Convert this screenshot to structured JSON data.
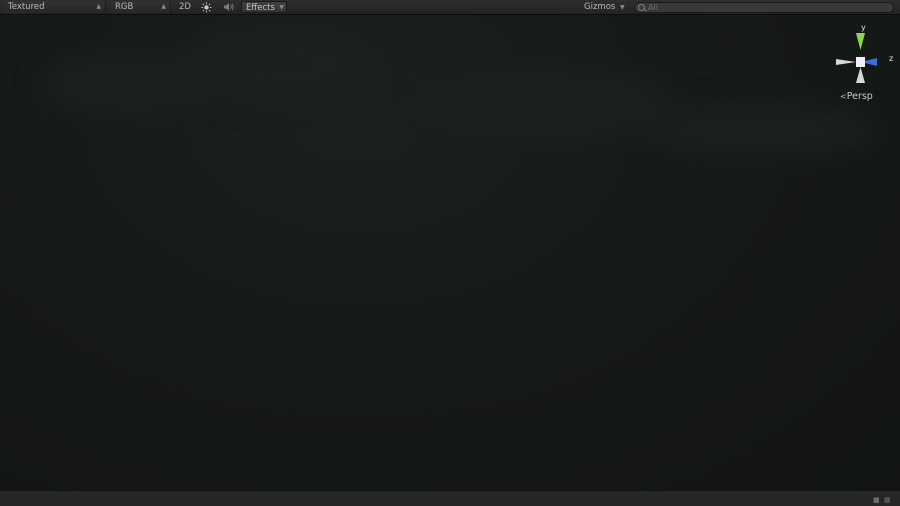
{
  "toolbar": {
    "draw_mode": "Textured",
    "render_mode": "RGB",
    "mode_2d": "2D",
    "lighting_icon": "sun-icon",
    "audio_icon": "speaker-icon",
    "effects_label": "Effects",
    "gizmos_label": "Gizmos",
    "search_placeholder": "All"
  },
  "scene_gizmo": {
    "y_label": "y",
    "z_label": "z",
    "projection_label": "Persp",
    "colors": {
      "y_axis": "#8bd54a",
      "z_axis": "#3a6fd8",
      "neutral": "#d8d8d8"
    }
  },
  "colors": {
    "viewport_bg": "#141716",
    "toolbar_bg": "#2a2a2a"
  }
}
